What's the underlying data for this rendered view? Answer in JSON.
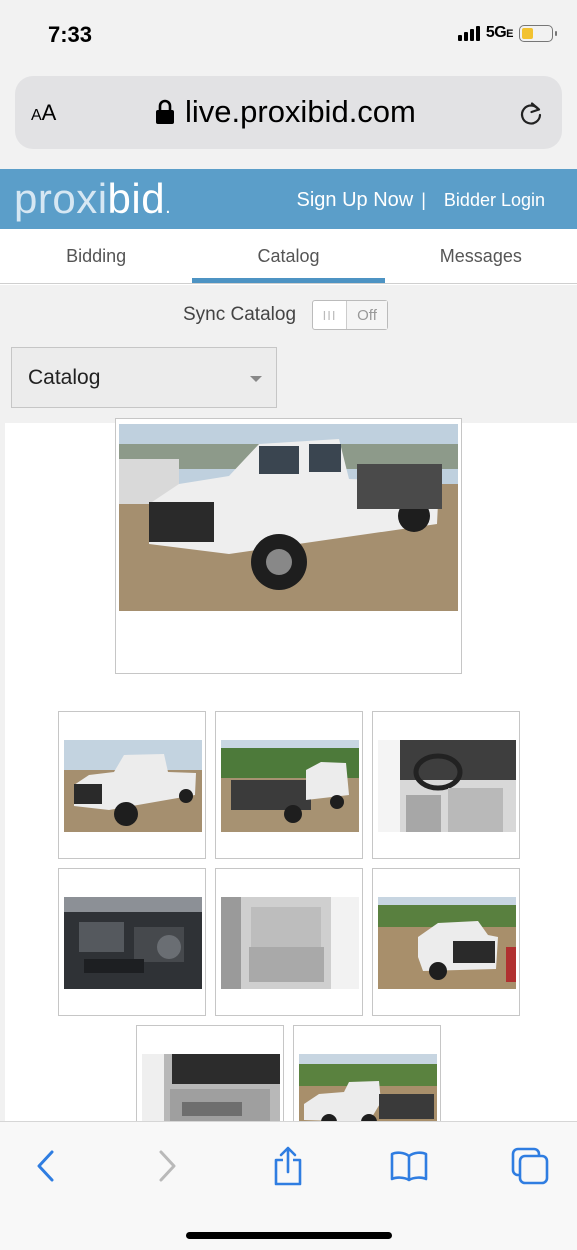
{
  "status_bar": {
    "time": "7:33",
    "network": "5G",
    "network_suffix": "E"
  },
  "browser": {
    "text_size_label_small": "A",
    "text_size_label_large": "A",
    "url": "live.proxibid.com"
  },
  "site": {
    "logo_part1": "proxi",
    "logo_part2": "bid",
    "logo_dot": ".",
    "sign_up": "Sign Up Now",
    "separator": "|",
    "login": "Bidder Login"
  },
  "tabs": [
    {
      "label": "Bidding",
      "active": false
    },
    {
      "label": "Catalog",
      "active": true
    },
    {
      "label": "Messages",
      "active": false
    }
  ],
  "sync": {
    "label": "Sync Catalog",
    "toggle_knob": "III",
    "toggle_state": "Off"
  },
  "catalog_select": {
    "selected": "Catalog"
  },
  "photos": {
    "main": "truck-front-three-quarter",
    "thumbnails": [
      "truck-front-three-quarter",
      "truck-rear-flatbed",
      "cab-interior-steering",
      "engine-bay",
      "rear-seat-interior",
      "truck-front-view",
      "door-panel-interior",
      "truck-side-flatbed"
    ]
  },
  "colors": {
    "header_blue": "#5b9ec9",
    "tab_accent": "#4d93c3",
    "ios_blue": "#2f7de1"
  },
  "toolbar_icons": [
    "back-icon",
    "forward-icon",
    "share-icon",
    "bookmarks-icon",
    "tabs-icon"
  ]
}
